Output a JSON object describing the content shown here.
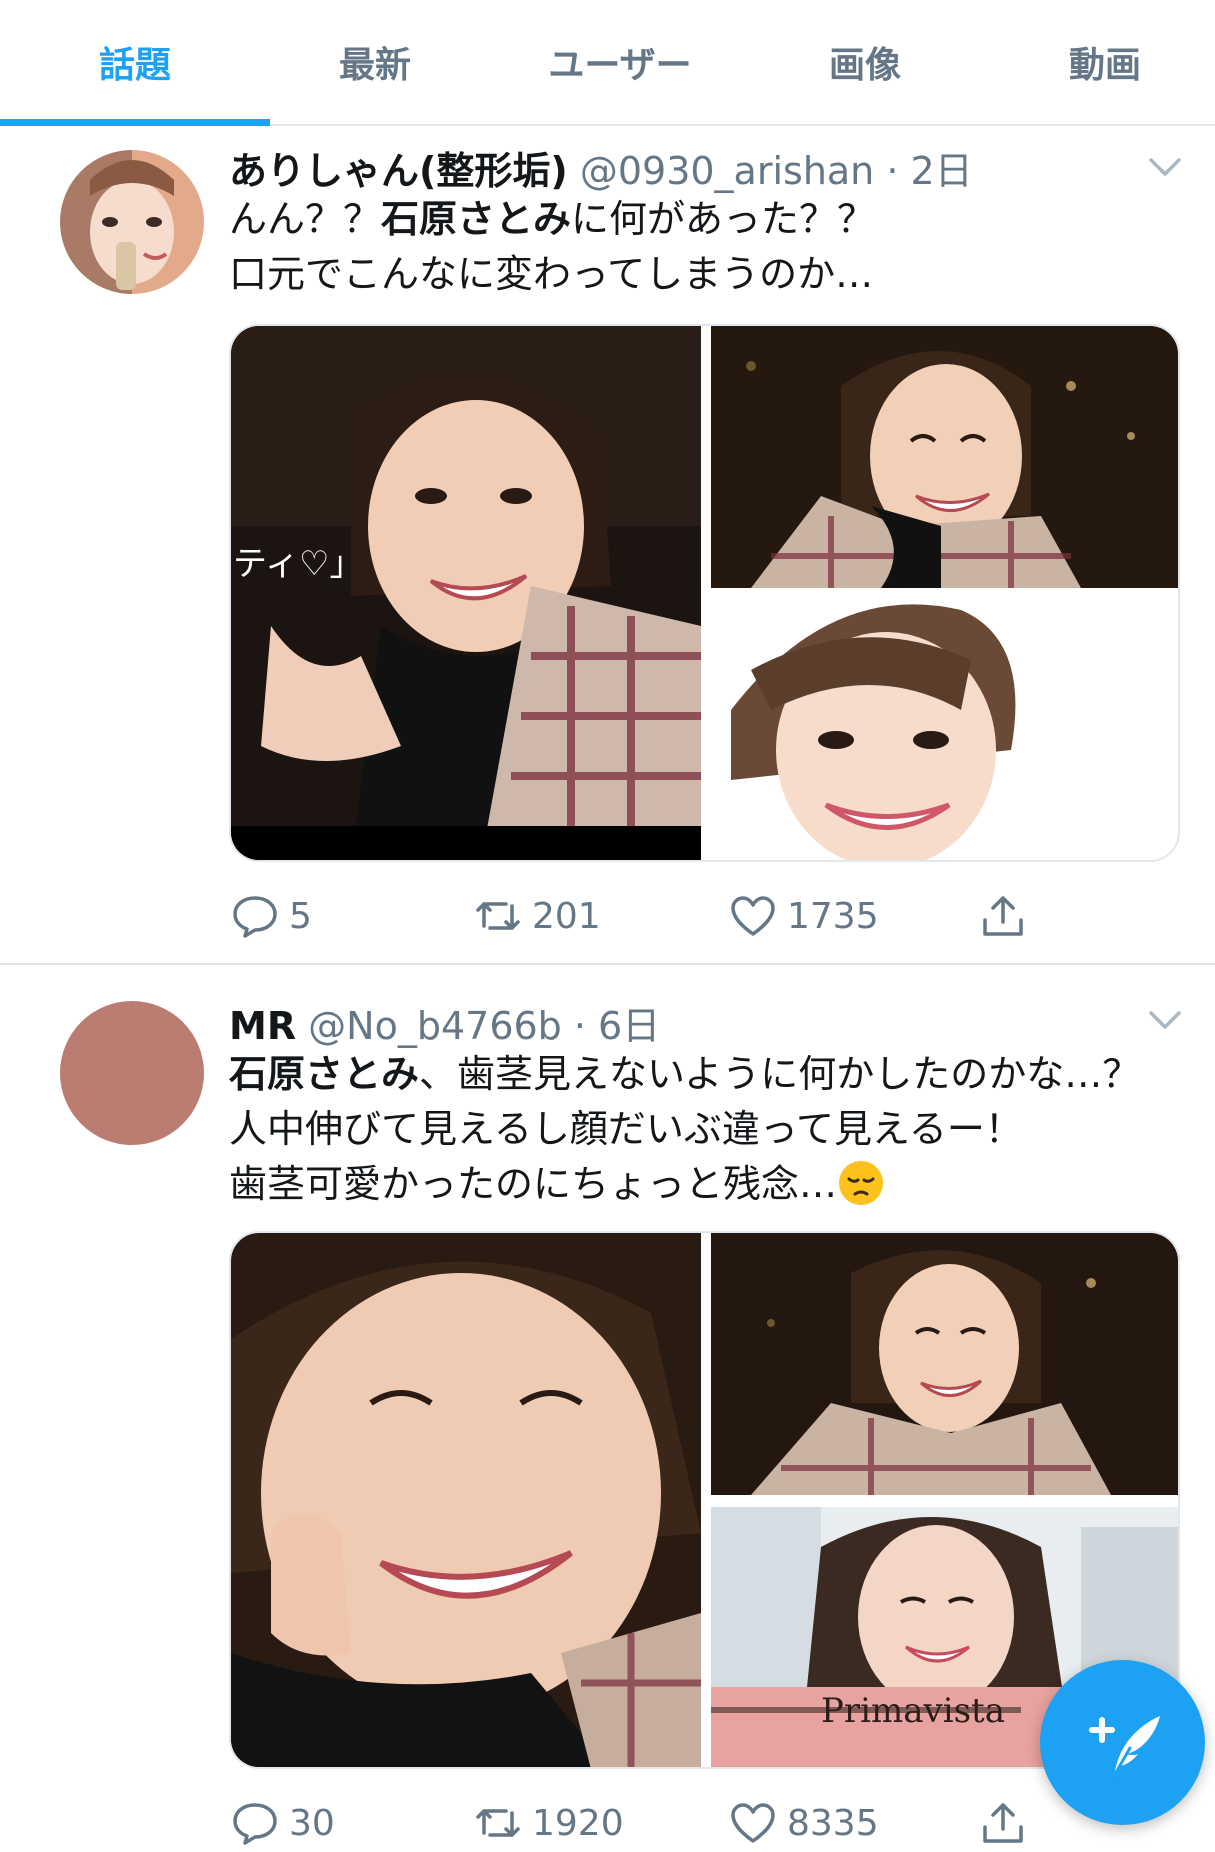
{
  "tabs": [
    {
      "label": "話題",
      "active": true
    },
    {
      "label": "最新",
      "active": false
    },
    {
      "label": "ユーザー",
      "active": false
    },
    {
      "label": "画像",
      "active": false
    },
    {
      "label": "動画",
      "active": false
    }
  ],
  "tweets": [
    {
      "name": "ありしゃん(整形垢)",
      "handle": "@0930_arishan",
      "time": "· 2日",
      "text": {
        "l1a": "んん？？",
        "l1b": "石原さとみ",
        "l1c": "に何があった？？",
        "l2": "口元でこんなに変わってしまうのか…"
      },
      "media_caption": "ティ♡」",
      "stats": {
        "replies": "5",
        "retweets": "201",
        "likes": "1735"
      }
    },
    {
      "name": "MR",
      "handle": "@No_b4766b",
      "time": "· 6日",
      "text": {
        "l1a": "石原さとみ",
        "l1b": "、歯茎見えないように何かしたのかな…？",
        "l2": "人中伸びて見えるし顔だいぶ違って見えるー！",
        "l3": "歯茎可愛かったのにちょっと残念…"
      },
      "media_caption": "Primavista",
      "stats": {
        "replies": "30",
        "retweets": "1920",
        "likes": "8335"
      }
    }
  ],
  "icons": {
    "reply": "reply-icon",
    "retweet": "retweet-icon",
    "like": "heart-icon",
    "share": "share-icon",
    "menu": "chevron-down-icon",
    "compose": "compose-tweet-icon",
    "emoji": "pensive-face-emoji"
  },
  "colors": {
    "accent": "#1da1f2",
    "secondary_text": "#657786",
    "divider": "#e1e8ed",
    "avatar_mr": "#bb7c71"
  }
}
